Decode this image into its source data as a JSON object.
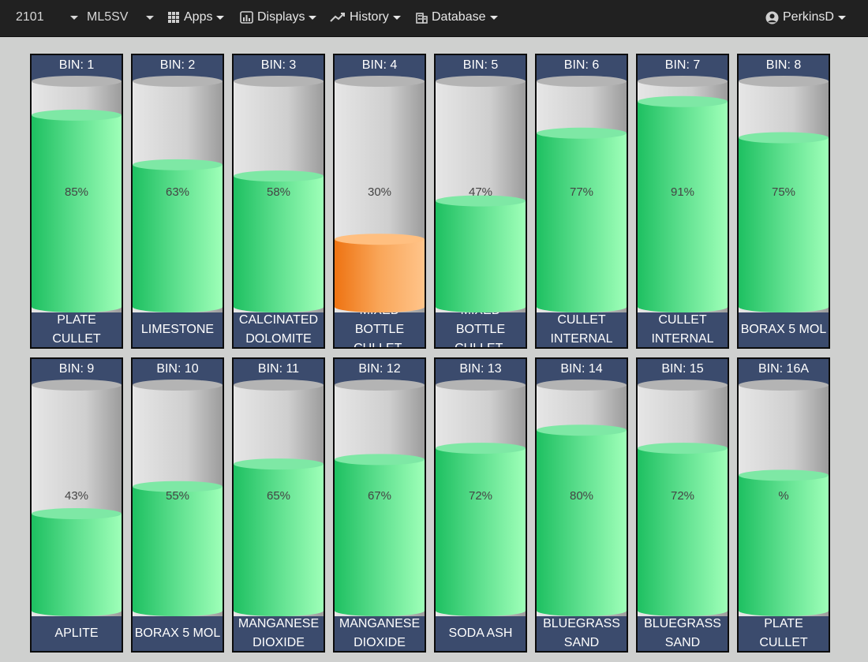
{
  "navbar": {
    "plant": "2101",
    "line": "ML5SV",
    "apps_label": "Apps",
    "displays_label": "Displays",
    "history_label": "History",
    "database_label": "Database",
    "user_label": "PerkinsD"
  },
  "colors": {
    "fill_normal": "#4ade80",
    "fill_warning": "#f7901e",
    "empty": "#d9d9d9",
    "header_bg": "#3b4b6d"
  },
  "bins": [
    {
      "header": "BIN: 1",
      "label": "PLATE CULLET",
      "percent_text": "85%",
      "level": 0.85,
      "status": "normal"
    },
    {
      "header": "BIN: 2",
      "label": "LIMESTONE",
      "percent_text": "63%",
      "level": 0.63,
      "status": "normal"
    },
    {
      "header": "BIN: 3",
      "label": "CALCINATED DOLOMITE",
      "percent_text": "58%",
      "level": 0.58,
      "status": "normal"
    },
    {
      "header": "BIN: 4",
      "label": "MIXED BOTTLE CULLET-",
      "percent_text": "30%",
      "level": 0.3,
      "status": "warning"
    },
    {
      "header": "BIN: 5",
      "label": "MIXED BOTTLE CULLET-",
      "percent_text": "47%",
      "level": 0.47,
      "status": "normal"
    },
    {
      "header": "BIN: 6",
      "label": "CULLET INTERNAL",
      "percent_text": "77%",
      "level": 0.77,
      "status": "normal"
    },
    {
      "header": "BIN: 7",
      "label": "CULLET INTERNAL",
      "percent_text": "91%",
      "level": 0.91,
      "status": "normal"
    },
    {
      "header": "BIN: 8",
      "label": "BORAX 5 MOL",
      "percent_text": "75%",
      "level": 0.75,
      "status": "normal"
    },
    {
      "header": "BIN: 9",
      "label": "APLITE",
      "percent_text": "43%",
      "level": 0.43,
      "status": "normal"
    },
    {
      "header": "BIN: 10",
      "label": "BORAX 5 MOL",
      "percent_text": "55%",
      "level": 0.55,
      "status": "normal"
    },
    {
      "header": "BIN: 11",
      "label": "MANGANESE DIOXIDE",
      "percent_text": "65%",
      "level": 0.65,
      "status": "normal"
    },
    {
      "header": "BIN: 12",
      "label": "MANGANESE DIOXIDE",
      "percent_text": "67%",
      "level": 0.67,
      "status": "normal"
    },
    {
      "header": "BIN: 13",
      "label": "SODA ASH",
      "percent_text": "72%",
      "level": 0.72,
      "status": "normal"
    },
    {
      "header": "BIN: 14",
      "label": "BLUEGRASS SAND",
      "percent_text": "80%",
      "level": 0.8,
      "status": "normal"
    },
    {
      "header": "BIN: 15",
      "label": "BLUEGRASS SAND",
      "percent_text": "72%",
      "level": 0.72,
      "status": "normal"
    },
    {
      "header": "BIN: 16A",
      "label": "PLATE CULLET",
      "percent_text": "%",
      "level": 0.6,
      "status": "normal"
    }
  ]
}
